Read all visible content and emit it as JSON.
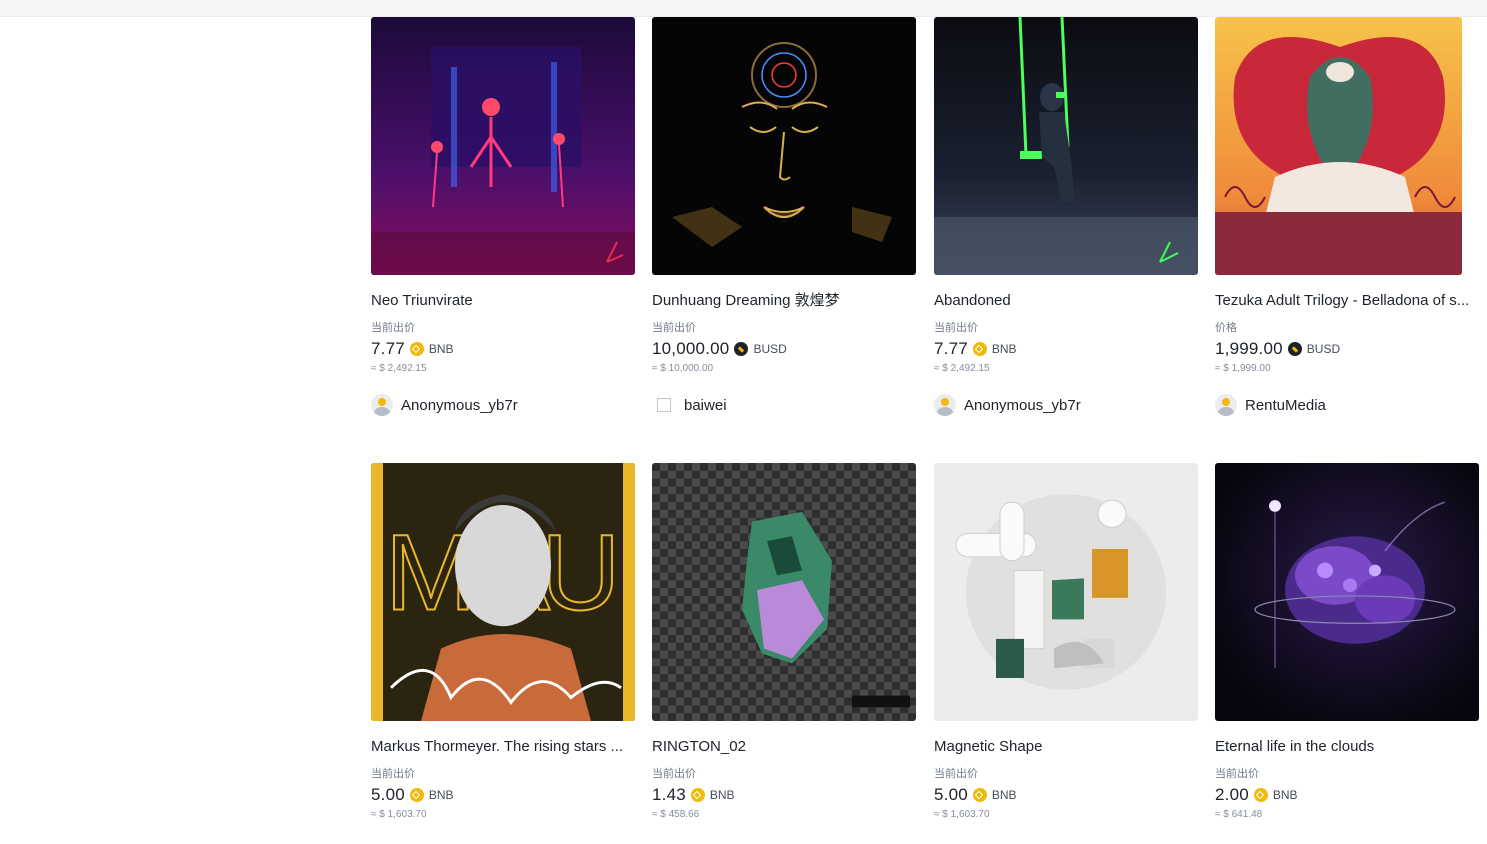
{
  "items": [
    {
      "title": "Neo Triunvirate",
      "price_label": "当前出价",
      "price": "7.77",
      "currency": "BNB",
      "coin": "bnb-coin-icon",
      "usd": "≈ $ 2,492.15",
      "creator": "Anonymous_yb7r",
      "avatar": "default-avatar"
    },
    {
      "title": "Dunhuang Dreaming 敦煌梦",
      "price_label": "当前出价",
      "price": "10,000.00",
      "currency": "BUSD",
      "coin": "busd-coin-icon",
      "usd": "≈ $ 10,000.00",
      "creator": "baiwei",
      "avatar": "broken-image-avatar"
    },
    {
      "title": "Abandoned",
      "price_label": "当前出价",
      "price": "7.77",
      "currency": "BNB",
      "coin": "bnb-coin-icon",
      "usd": "≈ $ 2,492.15",
      "creator": "Anonymous_yb7r",
      "avatar": "default-avatar"
    },
    {
      "title": "Tezuka Adult Trilogy - Belladona of s...",
      "price_label": "价格",
      "price": "1,999.00",
      "currency": "BUSD",
      "coin": "busd-coin-icon",
      "usd": "≈ $ 1,999.00",
      "creator": "RentuMedia",
      "avatar": "default-avatar"
    },
    {
      "title": "Markus Thormeyer. The rising stars ...",
      "price_label": "当前出价",
      "price": "5.00",
      "currency": "BNB",
      "coin": "bnb-coin-icon",
      "usd": "≈ $ 1,603.70"
    },
    {
      "title": "RINGTON_02",
      "price_label": "当前出价",
      "price": "1.43",
      "currency": "BNB",
      "coin": "bnb-coin-icon",
      "usd": "≈ $ 458.66"
    },
    {
      "title": "Magnetic Shape",
      "price_label": "当前出价",
      "price": "5.00",
      "currency": "BNB",
      "coin": "bnb-coin-icon",
      "usd": "≈ $ 1,603.70"
    },
    {
      "title": "Eternal life in the clouds",
      "price_label": "当前出价",
      "price": "2.00",
      "currency": "BNB",
      "coin": "bnb-coin-icon",
      "usd": "≈ $ 641.48"
    }
  ],
  "colors": {
    "bnb": "#f0b90b",
    "text_primary": "#1e2329",
    "text_secondary": "#707a8a"
  }
}
